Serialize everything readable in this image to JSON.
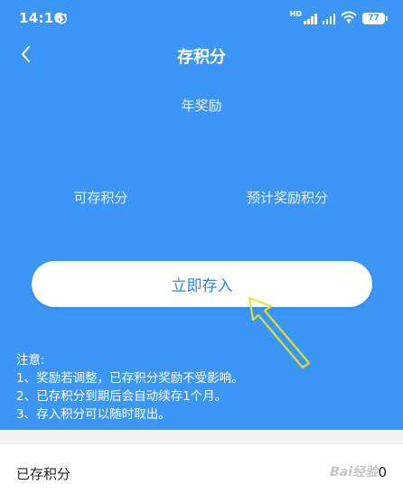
{
  "status_bar": {
    "time": "14:16",
    "network": "HD",
    "battery": "77",
    "icons": [
      "alarm-icon",
      "signal-icon",
      "wifi-icon",
      "battery-icon"
    ]
  },
  "nav": {
    "title": "存积分",
    "back_icon": "chevron-left-icon"
  },
  "summary": {
    "annual_label": "年奖励",
    "available_label": "可存积分",
    "expected_label": "预计奖励积分"
  },
  "action": {
    "deposit_label": "立即存入"
  },
  "notes": {
    "title": "注意:",
    "items": [
      "1、奖励若调整，已存积分奖励不受影响。",
      "2、已存积分到期后会自动续存1个月。",
      "3、存入积分可以随时取出。"
    ]
  },
  "deposited": {
    "label": "已存积分",
    "value": "0"
  },
  "watermark": "Bai经验",
  "colors": {
    "primary_blue": "#3b96f5",
    "button_text": "#2f86ee",
    "annotation_yellow": "#f2ef2a"
  }
}
